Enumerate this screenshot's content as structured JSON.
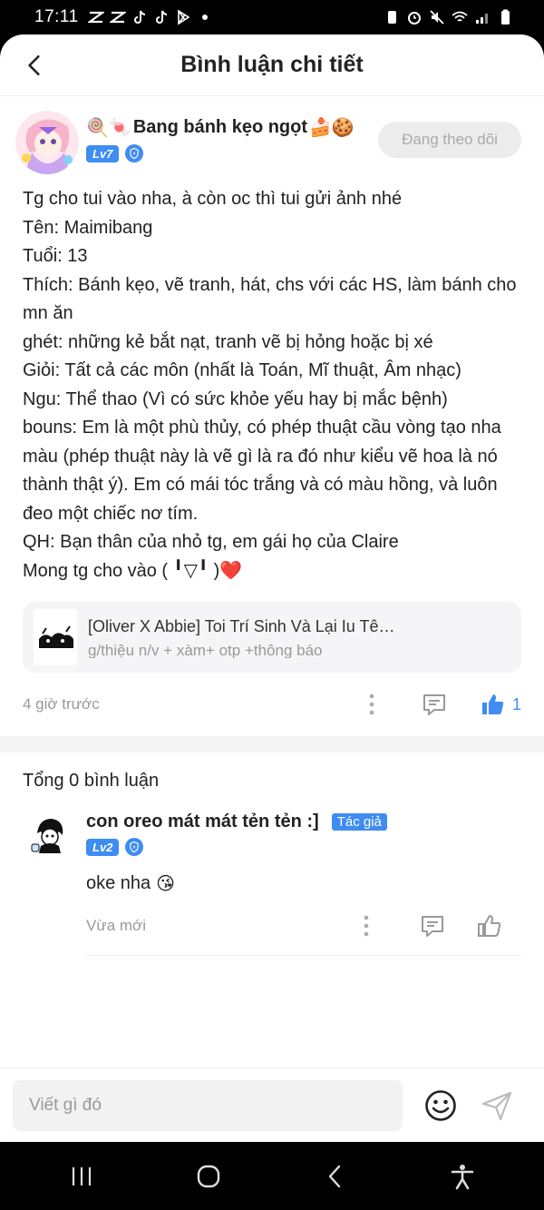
{
  "status_bar": {
    "time": "17:11"
  },
  "header": {
    "title": "Bình luận chi tiết"
  },
  "post": {
    "author": {
      "name_prefix": "🍭🍬",
      "name": "Bang bánh kẹo ngọt",
      "name_suffix": "🍰🍪",
      "level": "Lv7"
    },
    "follow_label": "Đang theo dõi",
    "lines": [
      "Tg cho tui vào nha, à còn oc thì tui gửi ảnh nhé",
      "Tên: Maimibang",
      "Tuổi: 13",
      "Thích: Bánh kẹo, vẽ tranh, hát, chs với các HS, làm bánh cho mn ăn",
      "ghét: những kẻ bắt nạt, tranh vẽ bị hỏng hoặc bị xé",
      "Giỏi: Tất cả các môn (nhất là Toán, Mĩ thuật, Âm nhạc)",
      "Ngu: Thể thao (Vì có sức khỏe yếu hay bị mắc bệnh)",
      "bouns: Em là một phù thủy, có phép thuật cầu vòng tạo nha màu (phép thuật này là vẽ gì là ra đó như kiểu vẽ hoa là nó thành thật ý). Em có mái tóc trắng và có màu hồng, và luôn đeo một chiếc nơ tím.",
      "QH: Bạn thân của nhỏ tg, em gái họ của Claire",
      "Mong tg cho vào ( ╹▽╹ )❤️"
    ],
    "link_card": {
      "title": "[Oliver X Abbie] Toi Trí Sinh Và Lại Iu Tê…",
      "subtitle": "g/thiệu n/v + xàm+ otp +thông báo"
    },
    "time": "4 giờ trước",
    "likes": "1"
  },
  "comments_section": {
    "total_label": "Tổng 0 bình luận",
    "items": [
      {
        "name": "con oreo mát mát tẻn tẻn :]",
        "author_tag": "Tác giả",
        "level": "Lv2",
        "text": "oke nha",
        "emoji": "😘",
        "time": "Vừa mới"
      }
    ]
  },
  "composer": {
    "placeholder": "Viết gì đó"
  },
  "colors": {
    "accent": "#3f8cf2",
    "muted": "#999999"
  }
}
